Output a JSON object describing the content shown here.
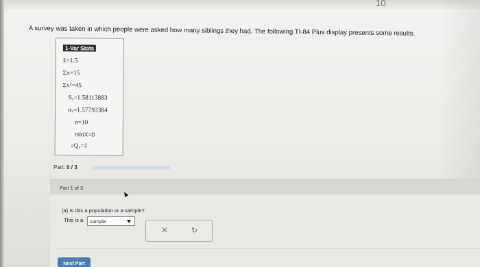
{
  "top": {
    "mark": "10"
  },
  "question": "A survey was taken in which people were asked how many siblings they had. The following TI-84 Plus display presents some results.",
  "calculator": {
    "title": "1-Var Stats",
    "lines": {
      "mean": "x̄=1.5",
      "sum_x": "Σx=15",
      "sum_x2": "Σx²=45",
      "sx": "Sₓ=1.58113883",
      "sigma_x": "σₓ=1.57793384",
      "n": "n=10",
      "minx": "minX=0",
      "q1": "↓Q₁=1"
    }
  },
  "part_progress": {
    "label": "Part: ",
    "value": "0 / 3",
    "fraction": 0.0
  },
  "part_panel": {
    "header": "Part 1 of 3",
    "question": "(a) Is this a population or a sample?",
    "answer_prefix": "This is a",
    "select_value": "sample"
  },
  "tools": {
    "clear_icon": "close-icon",
    "undo_icon": "redo-icon"
  },
  "buttons": {
    "next_part": "Next Part"
  },
  "colors": {
    "accent": "#4d7cb0",
    "progress_track": "#d5dde4"
  }
}
